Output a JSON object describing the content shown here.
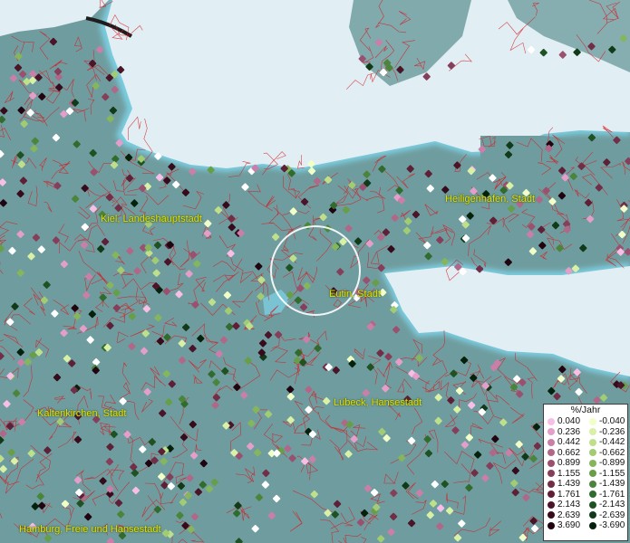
{
  "map": {
    "places": [
      {
        "name": "Kiel, Landeshauptstadt"
      },
      {
        "name": "Heiligenhafen, Stadt"
      },
      {
        "name": "Eutin, Stadt"
      },
      {
        "name": "Lübeck, Hansestadt"
      },
      {
        "name": "Kaltenkirchen, Stadt"
      },
      {
        "name": "Hamburg, Freie und Hansestadt"
      }
    ],
    "colors": {
      "land": "#6f9d9f",
      "sea": "#e1eef3",
      "coast_glow": "#7ccde0",
      "borders": "#d71920",
      "highlight_ring": "#ffffff"
    }
  },
  "legend": {
    "title": "%/Jahr",
    "positive": [
      {
        "label": "0.040",
        "color": "#f8bfe6"
      },
      {
        "label": "0.236",
        "color": "#e39ec9"
      },
      {
        "label": "0.442",
        "color": "#c97fa8"
      },
      {
        "label": "0.662",
        "color": "#b06889"
      },
      {
        "label": "0.899",
        "color": "#9a516f"
      },
      {
        "label": "1.155",
        "color": "#863f5a"
      },
      {
        "label": "1.439",
        "color": "#712e46"
      },
      {
        "label": "1.761",
        "color": "#5e2037"
      },
      {
        "label": "2.143",
        "color": "#4a1429"
      },
      {
        "label": "2.639",
        "color": "#360b1c"
      },
      {
        "label": "3.690",
        "color": "#200410"
      }
    ],
    "negative": [
      {
        "label": "-0.040",
        "color": "#f1ffc9"
      },
      {
        "label": "-0.236",
        "color": "#d9f0a7"
      },
      {
        "label": "-0.442",
        "color": "#bfe08a"
      },
      {
        "label": "-0.662",
        "color": "#a2cc73"
      },
      {
        "label": "-0.899",
        "color": "#85b65d"
      },
      {
        "label": "-1.155",
        "color": "#679e4a"
      },
      {
        "label": "-1.439",
        "color": "#4b853b"
      },
      {
        "label": "-1.761",
        "color": "#326b2e"
      },
      {
        "label": "-2.143",
        "color": "#1f5223"
      },
      {
        "label": "-2.639",
        "color": "#103a18"
      },
      {
        "label": "-3.690",
        "color": "#04210c"
      }
    ]
  }
}
